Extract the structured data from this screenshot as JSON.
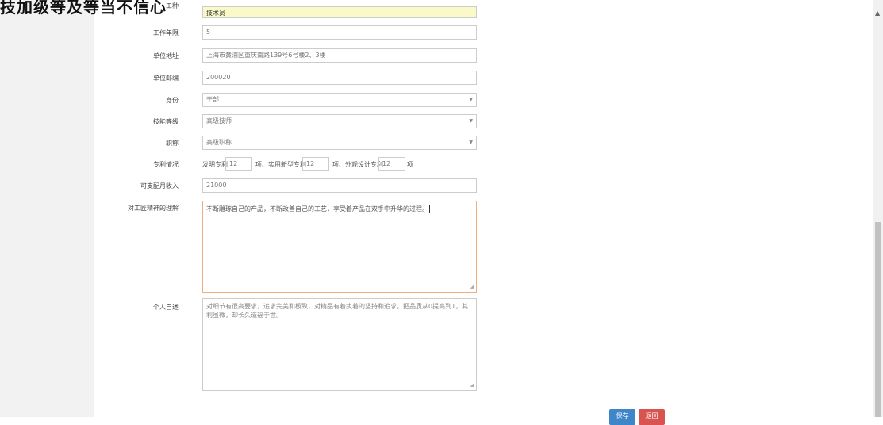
{
  "header": {
    "text": "技加级等及等当不信心"
  },
  "form": {
    "job_type": {
      "label": "工种",
      "value": "技术员"
    },
    "work_years": {
      "label": "工作年限",
      "value": "5"
    },
    "company_address": {
      "label": "单位地址",
      "value": "上海市黄浦区重庆南路139号6号楼2、3楼"
    },
    "company_postcode": {
      "label": "单位邮编",
      "value": "200020"
    },
    "identity": {
      "label": "身份",
      "value": "干部"
    },
    "skill_level": {
      "label": "技能等级",
      "value": "高级技师"
    },
    "title": {
      "label": "职称",
      "value": "高级职称"
    },
    "patents": {
      "label": "专利情况",
      "invention_label": "发明专利",
      "invention_value": "12",
      "utility_label": "项、实用新型专利",
      "utility_value": "12",
      "design_label": "项、外观设计专利",
      "design_value": "12",
      "unit": "项"
    },
    "monthly_income": {
      "label": "可支配月收入",
      "value": "21000"
    },
    "craftsmanship": {
      "label": "对工匠精神的理解",
      "value": "不断雕琢自己的产品，不断改善自己的工艺，享受着产品在双手中升华的过程。"
    },
    "self_intro": {
      "label": "个人自述",
      "value": "对细节有很高要求，追求完美和极致，对精品有着执着的坚持和追求，把品质从0提高到1，其利虽微，却长久造福于世。"
    }
  },
  "buttons": {
    "save": "保存",
    "back": "返回"
  },
  "colors": {
    "primary": "#3f86c9",
    "danger": "#d9534f",
    "highlight": "#fafac8",
    "focus_border": "#f0ad7e"
  },
  "icons": {
    "select_arrow": "chevron-down-icon",
    "scroll_up": "scroll-up-arrow-icon"
  }
}
